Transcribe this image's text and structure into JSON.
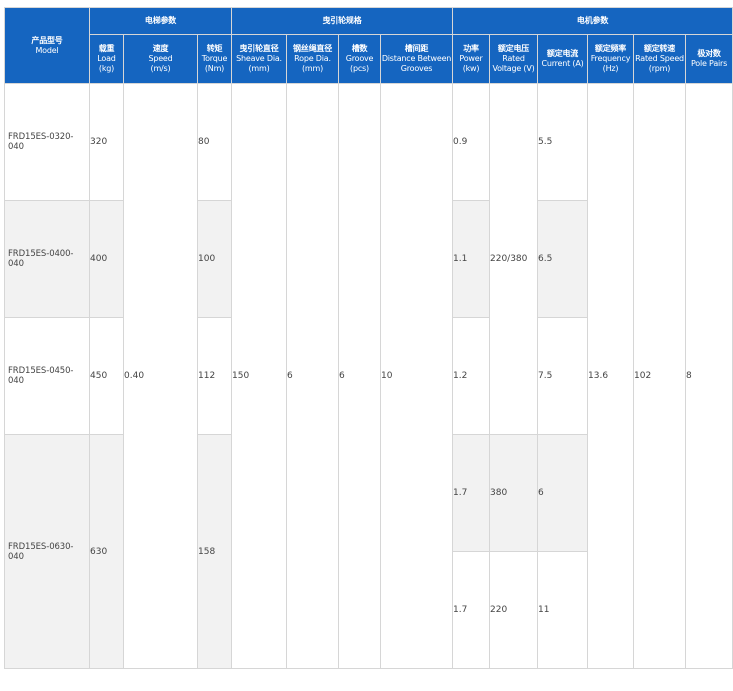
{
  "groups": {
    "elevator": "电梯参数",
    "sheave": "曳引轮规格",
    "motor": "电机参数"
  },
  "headers": {
    "model": {
      "zh": "产品型号",
      "en": "Model"
    },
    "load": {
      "zh": "载重",
      "en1": "Load",
      "en2": "(kg)"
    },
    "speed": {
      "zh": "速度",
      "en1": "Speed",
      "en2": "(m/s)"
    },
    "torque": {
      "zh": "转矩",
      "en1": "Torque",
      "en2": "(Nm)"
    },
    "sheave_dia": {
      "zh": "曳引轮直径",
      "en1": "Sheave Dia.",
      "en2": "(mm)"
    },
    "rope_dia": {
      "zh": "钢丝绳直径",
      "en1": "Rope Dia.",
      "en2": "(mm)"
    },
    "groove": {
      "zh": "槽数",
      "en1": "Groove",
      "en2": "(pcs)"
    },
    "distance": {
      "zh": "槽间距",
      "en1": "Distance Between",
      "en2": "Grooves"
    },
    "power": {
      "zh": "功率",
      "en1": "Power",
      "en2": "(kw)"
    },
    "voltage": {
      "zh": "额定电压",
      "en1": "Rated",
      "en2": "Voltage (V)"
    },
    "current": {
      "zh": "额定电流",
      "en1": "Current (A)"
    },
    "frequency": {
      "zh": "额定频率",
      "en1": "Frequency",
      "en2": "(Hz)"
    },
    "rated_speed": {
      "zh": "额定转速",
      "en1": "Rated Speed",
      "en2": "(rpm)"
    },
    "pole_pairs": {
      "zh": "极对数",
      "en1": "Pole Pairs"
    }
  },
  "rows": [
    {
      "model": "FRD15ES-0320-040",
      "load": "320",
      "torque": "80",
      "power": "0.9",
      "current": "5.5"
    },
    {
      "model": "FRD15ES-0400-040",
      "load": "400",
      "torque": "100",
      "power": "1.1",
      "current": "6.5"
    },
    {
      "model": "FRD15ES-0450-040",
      "load": "450",
      "torque": "112",
      "power": "1.2",
      "current": "7.5"
    },
    {
      "model": "FRD15ES-0630-040",
      "load": "630",
      "torque": "158",
      "power_a": "1.7",
      "voltage_a": "380",
      "current_a": "6",
      "power_b": "1.7",
      "voltage_b": "220",
      "current_b": "11"
    }
  ],
  "shared": {
    "speed": "0.40",
    "sheave_dia": "150",
    "rope_dia": "6",
    "groove": "6",
    "distance": "10",
    "voltage": "220/380",
    "frequency": "13.6",
    "rated_speed": "102",
    "pole_pairs": "8"
  }
}
